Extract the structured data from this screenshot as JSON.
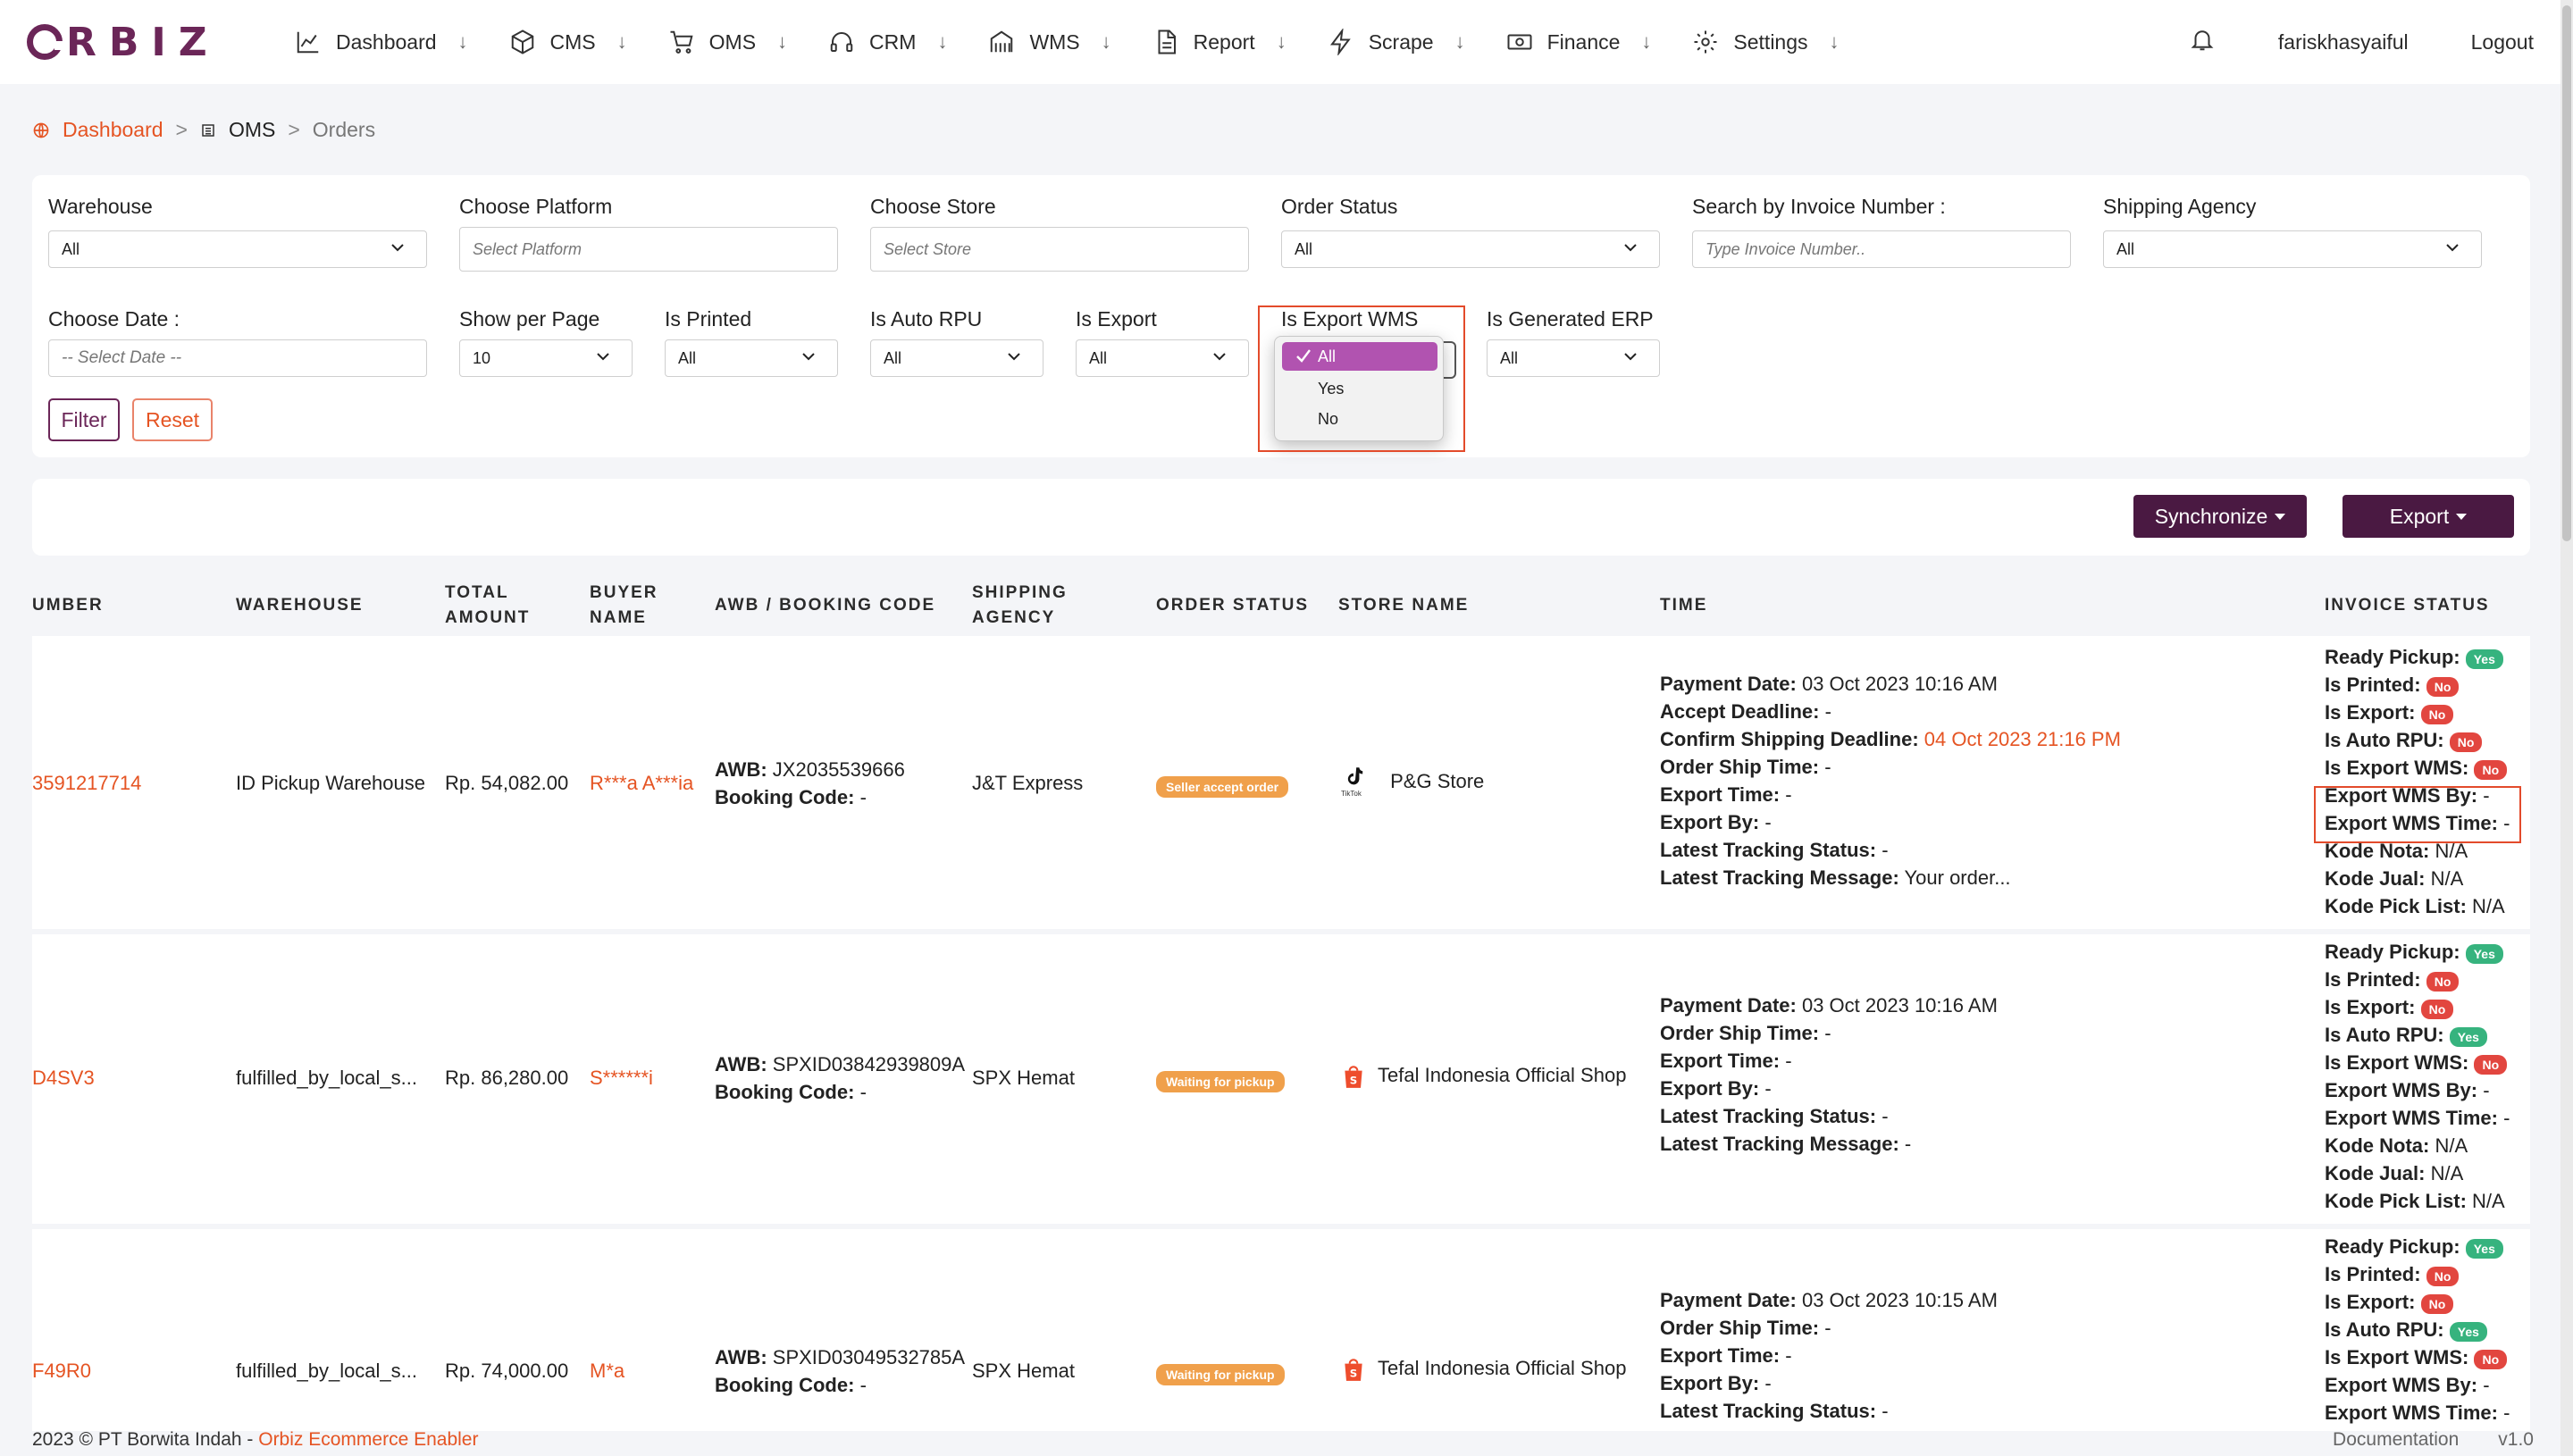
{
  "brand": {
    "logo_text": "RBIZ"
  },
  "nav": {
    "items": [
      {
        "label": "Dashboard",
        "icon": "chart-line-icon"
      },
      {
        "label": "CMS",
        "icon": "box-icon"
      },
      {
        "label": "OMS",
        "icon": "cart-icon"
      },
      {
        "label": "CRM",
        "icon": "headset-icon"
      },
      {
        "label": "WMS",
        "icon": "warehouse-icon"
      },
      {
        "label": "Report",
        "icon": "document-icon"
      },
      {
        "label": "Scrape",
        "icon": "bolt-icon"
      },
      {
        "label": "Finance",
        "icon": "money-icon"
      },
      {
        "label": "Settings",
        "icon": "gear-icon"
      }
    ],
    "arrow": "↓",
    "username": "fariskhasyaiful",
    "logout": "Logout"
  },
  "breadcrumb": {
    "dashboard": "Dashboard",
    "oms": "OMS",
    "current": "Orders",
    "sep": ">"
  },
  "filters": {
    "warehouse": {
      "label": "Warehouse",
      "value": "All"
    },
    "platform": {
      "label": "Choose Platform",
      "placeholder": "Select Platform"
    },
    "store": {
      "label": "Choose Store",
      "placeholder": "Select Store"
    },
    "order_status": {
      "label": "Order Status",
      "value": "All"
    },
    "invoice": {
      "label": "Search by Invoice Number :",
      "placeholder": "Type Invoice Number.."
    },
    "shipping_agency": {
      "label": "Shipping Agency",
      "value": "All"
    },
    "date": {
      "label": "Choose Date :",
      "placeholder": "-- Select Date --"
    },
    "per_page": {
      "label": "Show per Page",
      "value": "10"
    },
    "is_printed": {
      "label": "Is Printed",
      "value": "All"
    },
    "is_auto_rpu": {
      "label": "Is Auto RPU",
      "value": "All"
    },
    "is_export": {
      "label": "Is Export",
      "value": "All"
    },
    "is_export_wms": {
      "label": "Is Export WMS",
      "options": [
        "All",
        "Yes",
        "No"
      ],
      "selected": "All"
    },
    "is_generated_erp": {
      "label": "Is Generated ERP",
      "value": "All"
    },
    "filter_button": "Filter",
    "reset_button": "Reset"
  },
  "actions": {
    "synchronize": "Synchronize",
    "export": "Export"
  },
  "table": {
    "headers": {
      "number": "UMBER",
      "warehouse": "WAREHOUSE",
      "total_amount_1": "TOTAL",
      "total_amount_2": "AMOUNT",
      "buyer_1": "BUYER",
      "buyer_2": "NAME",
      "awb": "AWB / BOOKING CODE",
      "shipping_1": "SHIPPING",
      "shipping_2": "AGENCY",
      "order_status": "ORDER STATUS",
      "store": "STORE NAME",
      "time": "TIME",
      "invoice_status": "INVOICE STATUS"
    },
    "labels": {
      "awb": "AWB:",
      "booking": "Booking Code:",
      "payment_date": "Payment Date:",
      "accept_deadline": "Accept Deadline:",
      "confirm_deadline": "Confirm Shipping Deadline:",
      "order_ship_time": "Order Ship Time:",
      "export_time": "Export Time:",
      "export_by": "Export By:",
      "latest_status": "Latest Tracking Status:",
      "latest_message": "Latest Tracking Message:",
      "ready_pickup": "Ready Pickup:",
      "is_printed": "Is Printed:",
      "is_export": "Is Export:",
      "is_auto_rpu": "Is Auto RPU:",
      "is_export_wms": "Is Export WMS:",
      "export_wms_by": "Export WMS By:",
      "export_wms_time": "Export WMS Time:",
      "kode_nota": "Kode Nota:",
      "kode_jual": "Kode Jual:",
      "kode_pick_list": "Kode Pick List:"
    },
    "rows": [
      {
        "number": "3591217714",
        "warehouse": "ID Pickup Warehouse",
        "total": "Rp. 54,082.00",
        "buyer": "R***a A***ia",
        "awb": "JX2035539666",
        "booking": "-",
        "agency": "J&T Express",
        "status": "Seller accept order",
        "store_icon": "tiktok-icon",
        "store_icon_caption": "TikTok",
        "store": "P&G Store",
        "payment_date": "03 Oct 2023 10:16 AM",
        "accept_deadline": "-",
        "confirm_deadline": "04 Oct 2023 21:16 PM",
        "order_ship_time": "-",
        "export_time": "-",
        "export_by": "-",
        "latest_status": "-",
        "latest_message": "Your order...",
        "ready_pickup": "Yes",
        "is_printed": "No",
        "is_export": "No",
        "is_auto_rpu": "No",
        "is_export_wms": "No",
        "export_wms_by": "-",
        "export_wms_time": "-",
        "kode_nota": "N/A",
        "kode_jual": "N/A",
        "kode_pick_list": "N/A"
      },
      {
        "number": "D4SV3",
        "warehouse": "fulfilled_by_local_s...",
        "total": "Rp. 86,280.00",
        "buyer": "S******i",
        "awb": "SPXID03842939809A",
        "booking": "-",
        "agency": "SPX Hemat",
        "status": "Waiting for pickup",
        "store_icon": "shopee-icon",
        "store": "Tefal Indonesia Official Shop",
        "payment_date": "03 Oct 2023 10:16 AM",
        "order_ship_time": "-",
        "export_time": "-",
        "export_by": "-",
        "latest_status": "-",
        "latest_message": "-",
        "ready_pickup": "Yes",
        "is_printed": "No",
        "is_export": "No",
        "is_auto_rpu": "Yes",
        "is_export_wms": "No",
        "export_wms_by": "-",
        "export_wms_time": "-",
        "kode_nota": "N/A",
        "kode_jual": "N/A",
        "kode_pick_list": "N/A"
      },
      {
        "number": "F49R0",
        "warehouse": "fulfilled_by_local_s...",
        "total": "Rp. 74,000.00",
        "buyer": "M*a",
        "awb": "SPXID03049532785A",
        "booking": "-",
        "agency": "SPX Hemat",
        "status": "Waiting for pickup",
        "store_icon": "shopee-icon",
        "store": "Tefal Indonesia Official Shop",
        "payment_date": "03 Oct 2023 10:15 AM",
        "order_ship_time": "-",
        "export_time": "-",
        "export_by": "-",
        "latest_status": "-",
        "ready_pickup": "Yes",
        "is_printed": "No",
        "is_export": "No",
        "is_auto_rpu": "Yes",
        "is_export_wms": "No",
        "export_wms_by": "-",
        "export_wms_time": "-"
      }
    ]
  },
  "footer": {
    "copyright": "2023 © PT Borwita Indah - ",
    "link": "Orbiz Ecommerce Enabler",
    "documentation": "Documentation",
    "version": "v1.0"
  },
  "colors": {
    "brand": "#6b2658",
    "accent": "#e55423",
    "button_dark": "#4a1942",
    "dropdown_selected": "#b153b0",
    "highlight_border": "#e34b2b"
  }
}
